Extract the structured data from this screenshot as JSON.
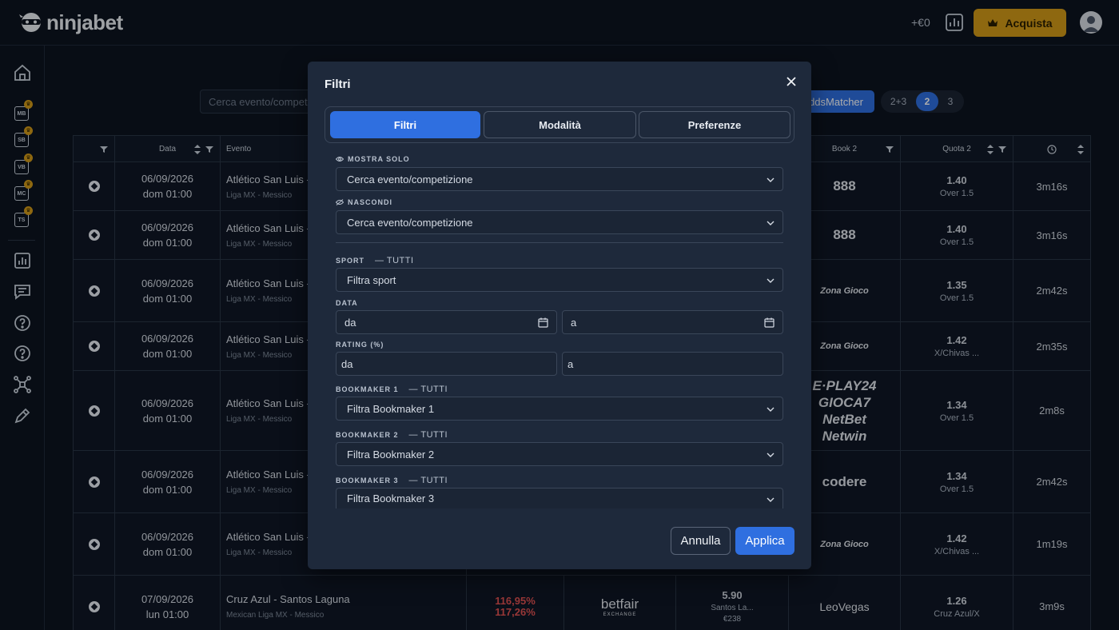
{
  "header": {
    "logo_text": "ninjabet",
    "balance": "+€0",
    "buy_label": "Acquista"
  },
  "sidebar": {
    "badges": [
      "MB",
      "SB",
      "VB",
      "MC",
      "TS"
    ]
  },
  "toolbar": {
    "search_placeholder": "Cerca evento/competizione",
    "oddsmatcher_label": "OddsMatcher",
    "pages": [
      "2+3",
      "2",
      "3"
    ]
  },
  "table": {
    "headers": {
      "data": "Data",
      "evento": "Evento",
      "book2": "Book 2",
      "quota2": "Quota 2"
    },
    "rows": [
      {
        "date": "06/09/2026",
        "time": "dom 01:00",
        "event": "Atlético San Luis -",
        "league": "Liga MX - Messico",
        "book2": "888",
        "quota": "1.40",
        "market": "Over 1.5",
        "elapsed": "3m16s"
      },
      {
        "date": "06/09/2026",
        "time": "dom 01:00",
        "event": "Atlético San Luis -",
        "league": "Liga MX - Messico",
        "book2": "888",
        "quota": "1.40",
        "market": "Over 1.5",
        "elapsed": "3m16s"
      },
      {
        "date": "06/09/2026",
        "time": "dom 01:00",
        "event": "Atlético San Luis -",
        "league": "Liga MX - Messico",
        "book2": "Zona Gioco",
        "quota": "1.35",
        "market": "Over 1.5",
        "elapsed": "2m42s"
      },
      {
        "date": "06/09/2026",
        "time": "dom 01:00",
        "event": "Atlético San Luis -",
        "league": "Liga MX - Messico",
        "book2": "Zona Gioco",
        "quota": "1.42",
        "market": "X/Chivas ...",
        "elapsed": "2m35s"
      },
      {
        "date": "06/09/2026",
        "time": "dom 01:00",
        "event": "Atlético San Luis -",
        "league": "Liga MX - Messico",
        "book2_multi": [
          "E·PLAY24",
          "GIOCA7",
          "NetBet",
          "Netwin"
        ],
        "quota": "1.34",
        "market": "Over 1.5",
        "elapsed": "2m8s"
      },
      {
        "date": "06/09/2026",
        "time": "dom 01:00",
        "event": "Atlético San Luis -",
        "league": "Liga MX - Messico",
        "book2": "codere",
        "quota": "1.34",
        "market": "Over 1.5",
        "elapsed": "2m42s"
      },
      {
        "date": "06/09/2026",
        "time": "dom 01:00",
        "event": "Atlético San Luis -",
        "league": "Liga MX - Messico",
        "book2": "Zona Gioco",
        "quota": "1.42",
        "market": "X/Chivas ...",
        "elapsed": "1m19s"
      },
      {
        "date": "07/09/2026",
        "time": "lun 01:00",
        "event": "Cruz Azul - Santos Laguna",
        "league": "Mexican Liga MX - Messico",
        "rating1": "116,95%",
        "rating2": "117,26%",
        "book1": "betfair",
        "book1_sub": "EXCHANGE",
        "q1": "5.90",
        "q1_market": "Santos La...",
        "q1_stake": "€238",
        "book2": "LeoVegas",
        "quota": "1.26",
        "market": "Cruz Azul/X",
        "elapsed": "3m9s"
      }
    ]
  },
  "modal": {
    "title": "Filtri",
    "tabs": [
      "Filtri",
      "Modalità",
      "Preferenze"
    ],
    "mostra_solo_label": "MOSTRA SOLO",
    "mostra_solo_value": "Cerca evento/competizione",
    "nascondi_label": "NASCONDI",
    "nascondi_value": "Cerca evento/competizione",
    "sport_label": "SPORT",
    "all_label": "— TUTTI",
    "sport_value": "Filtra sport",
    "data_label": "DATA",
    "date_from": "da",
    "date_to": "a",
    "rating_label": "RATING (%)",
    "rating_from": "da",
    "rating_to": "a",
    "bookmaker1_label": "BOOKMAKER 1",
    "bookmaker1_value": "Filtra Bookmaker 1",
    "bookmaker2_label": "BOOKMAKER 2",
    "bookmaker2_value": "Filtra Bookmaker 2",
    "bookmaker3_label": "BOOKMAKER 3",
    "bookmaker3_value": "Filtra Bookmaker 3",
    "cancel_label": "Annulla",
    "apply_label": "Applica"
  },
  "colors": {
    "accent": "#2f6fe0",
    "gold": "#d29a18",
    "negative": "#e05252"
  }
}
